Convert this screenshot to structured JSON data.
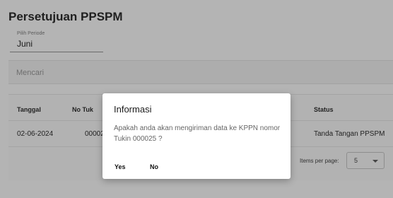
{
  "page": {
    "title": "Persetujuan PPSPM"
  },
  "period": {
    "label": "Pilih Periode",
    "value": "Juni"
  },
  "search": {
    "placeholder": "Mencari"
  },
  "table": {
    "headers": {
      "tanggal": "Tanggal",
      "no_tukin": "No Tuk",
      "status": "Status"
    },
    "rows": [
      {
        "tanggal": "02-06-2024",
        "no_tukin": "00002",
        "status": "Tanda Tangan PPSPM"
      }
    ]
  },
  "pagination": {
    "items_per_page_label": "Items per page:",
    "items_per_page_value": "5"
  },
  "dialog": {
    "title": "Informasi",
    "message": "Apakah anda akan mengiriman data ke KPPN nomor Tukin 000025 ?",
    "yes_label": "Yes",
    "no_label": "No"
  },
  "colors": {
    "overlay": "#b4b4b4",
    "dialog_bg": "#ffffff"
  }
}
